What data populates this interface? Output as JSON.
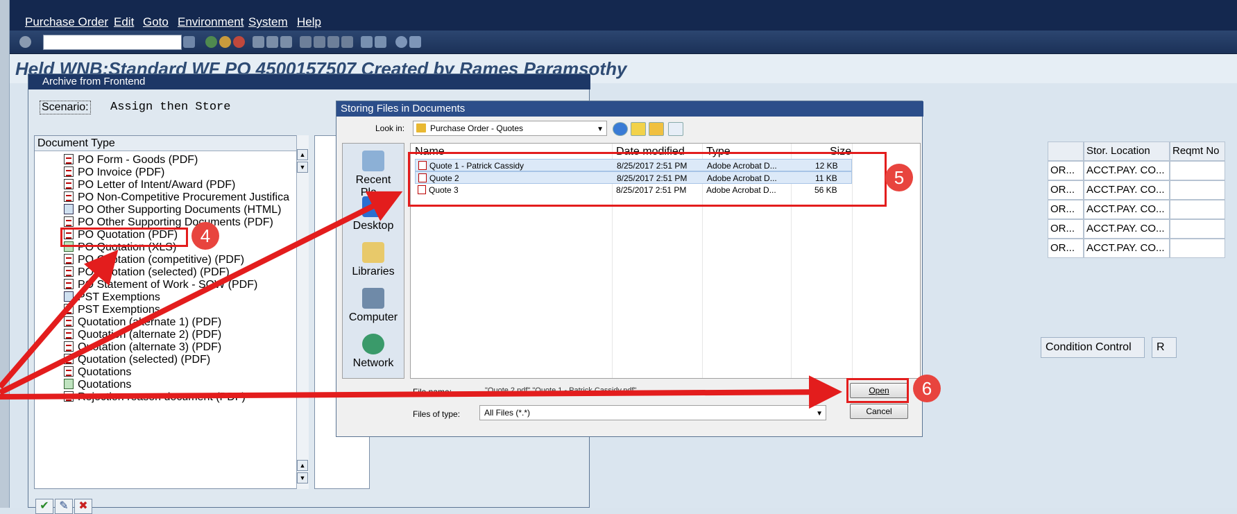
{
  "menu": {
    "items": [
      "Purchase Order",
      "Edit",
      "Goto",
      "Environment",
      "System",
      "Help"
    ]
  },
  "page": {
    "title": "Held WNB:Standard WF PO 4500157507 Created by Rames Paramsothy"
  },
  "background_grid": {
    "headers": [
      "Stor. Location",
      "Reqmt No"
    ],
    "rows": [
      [
        "OR...",
        "ACCT.PAY. CO..."
      ],
      [
        "OR...",
        "ACCT.PAY. CO..."
      ],
      [
        "OR...",
        "ACCT.PAY. CO..."
      ],
      [
        "OR...",
        "ACCT.PAY. CO..."
      ],
      [
        "OR...",
        "ACCT.PAY. CO..."
      ]
    ],
    "tabs": [
      "Condition Control",
      "R"
    ]
  },
  "archive_dialog": {
    "title": "Archive from Frontend",
    "scenario_label": "Scenario:",
    "scenario_value": "Assign then Store",
    "list_header": "Document Type",
    "document_types": [
      {
        "label": "PO Form - Goods (PDF)",
        "icon": "pdf-icon"
      },
      {
        "label": "PO Invoice (PDF)",
        "icon": "pdf-icon"
      },
      {
        "label": "PO Letter of Intent/Award (PDF)",
        "icon": "pdf-icon"
      },
      {
        "label": "PO Non-Competitive Procurement Justifica",
        "icon": "pdf-icon"
      },
      {
        "label": "PO Other Supporting Documents (HTML)",
        "icon": "html-doc-icon"
      },
      {
        "label": "PO Other Supporting Documents (PDF)",
        "icon": "pdf-icon"
      },
      {
        "label": "PO Quotation (PDF)",
        "icon": "pdf-icon"
      },
      {
        "label": "PO Quotation (XLS)",
        "icon": "xls-icon"
      },
      {
        "label": "PO Quotation (competitive) (PDF)",
        "icon": "pdf-icon"
      },
      {
        "label": "PO Quotation (selected) (PDF)",
        "icon": "pdf-icon"
      },
      {
        "label": "PO Statement of Work - SOW (PDF)",
        "icon": "pdf-icon"
      },
      {
        "label": "PST Exemptions",
        "icon": "html-doc-icon"
      },
      {
        "label": "PST Exemptions",
        "icon": "pdf-icon"
      },
      {
        "label": "Quotation (alternate 1) (PDF)",
        "icon": "pdf-icon"
      },
      {
        "label": "Quotation (alternate 2) (PDF)",
        "icon": "pdf-icon"
      },
      {
        "label": "Quotation (alternate 3) (PDF)",
        "icon": "pdf-icon"
      },
      {
        "label": "Quotation (selected)   (PDF)",
        "icon": "pdf-icon"
      },
      {
        "label": "Quotations",
        "icon": "pdf-icon"
      },
      {
        "label": "Quotations",
        "icon": "xls-icon"
      },
      {
        "label": "Rejection reason document (PDF)",
        "icon": "pdf-icon"
      }
    ]
  },
  "storing_dialog": {
    "title": "Storing Files in Documents",
    "look_in_label": "Look in:",
    "look_in_value": "Purchase Order - Quotes",
    "places": [
      "Recent Pla...",
      "Desktop",
      "Libraries",
      "Computer",
      "Network"
    ],
    "columns": [
      "Name",
      "Date modified",
      "Type",
      "Size"
    ],
    "files": [
      {
        "name": "Quote 1 - Patrick Cassidy",
        "date": "8/25/2017 2:51 PM",
        "type": "Adobe Acrobat D...",
        "size": "12 KB"
      },
      {
        "name": "Quote 2",
        "date": "8/25/2017 2:51 PM",
        "type": "Adobe Acrobat D...",
        "size": "11 KB"
      },
      {
        "name": "Quote 3",
        "date": "8/25/2017 2:51 PM",
        "type": "Adobe Acrobat D...",
        "size": "56 KB"
      }
    ],
    "file_name_label": "File name:",
    "file_name_value": "\"Quote 2.pdf\" \"Quote 1 - Patrick Cassidy.pdf\"",
    "files_of_type_label": "Files of type:",
    "files_of_type_value": "All Files (*.*)",
    "open_button": "Open",
    "cancel_button": "Cancel"
  },
  "annotations": {
    "badges": [
      "4",
      "5",
      "6"
    ],
    "color": "#e31d1d"
  },
  "colors": {
    "sap_menubar": "#14284f",
    "dialog_titlebar": "#1d3766",
    "title_text": "#2e4b74"
  }
}
